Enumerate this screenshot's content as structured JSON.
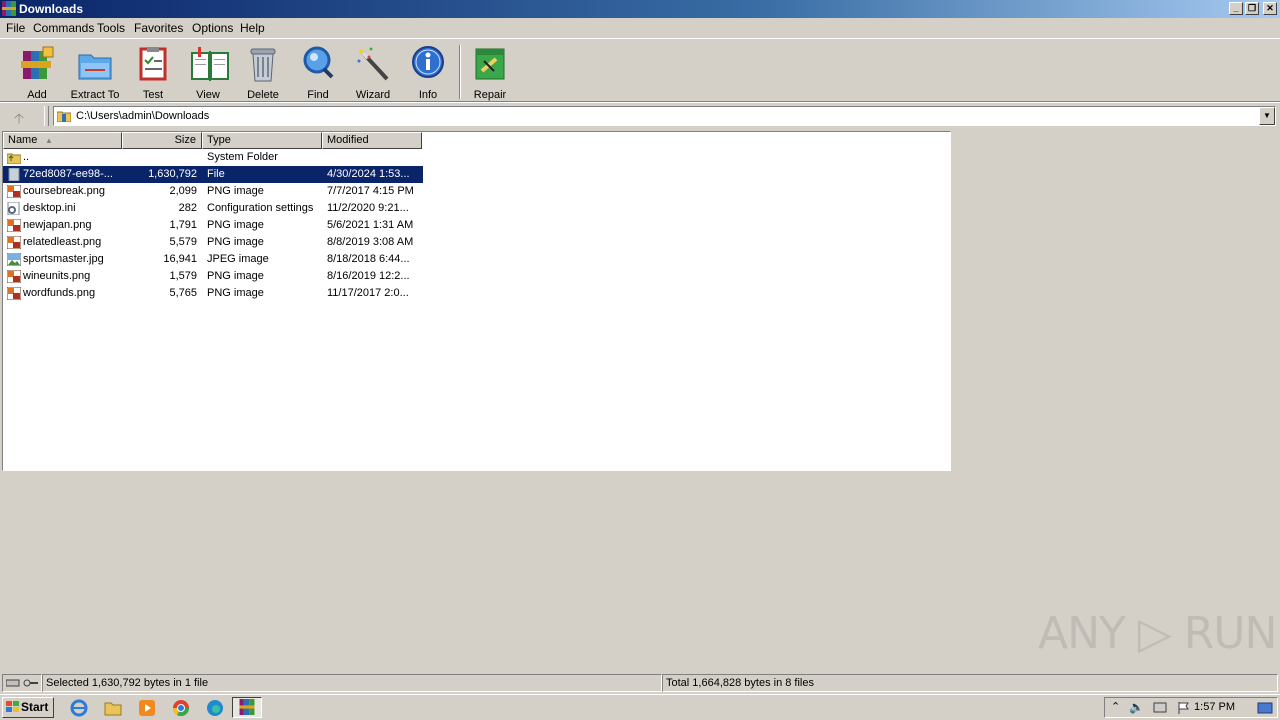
{
  "window": {
    "title": "Downloads",
    "min": "_",
    "restore": "❐",
    "close": "✕"
  },
  "menu": [
    "File",
    "Commands",
    "Tools",
    "Favorites",
    "Options",
    "Help"
  ],
  "toolbar": [
    "Add",
    "Extract To",
    "Test",
    "View",
    "Delete",
    "Find",
    "Wizard",
    "Info",
    "Repair"
  ],
  "address": {
    "path": "C:\\Users\\admin\\Downloads",
    "up": "🡡",
    "drop": "▼"
  },
  "columns": {
    "name": "Name",
    "size": "Size",
    "type": "Type",
    "modified": "Modified"
  },
  "files": [
    {
      "name": "..",
      "size": "",
      "type": "System Folder",
      "modified": "",
      "icon": "folder-up-icon"
    },
    {
      "name": "72ed8087-ee98-...",
      "size": "1,630,792",
      "type": "File",
      "modified": "4/30/2024 1:53...",
      "icon": "file-icon",
      "selected": true
    },
    {
      "name": "coursebreak.png",
      "size": "2,099",
      "type": "PNG image",
      "modified": "7/7/2017 4:15 PM",
      "icon": "png-icon"
    },
    {
      "name": "desktop.ini",
      "size": "282",
      "type": "Configuration settings",
      "modified": "11/2/2020 9:21...",
      "icon": "ini-icon"
    },
    {
      "name": "newjapan.png",
      "size": "1,791",
      "type": "PNG image",
      "modified": "5/6/2021 1:31 AM",
      "icon": "png-icon"
    },
    {
      "name": "relatedleast.png",
      "size": "5,579",
      "type": "PNG image",
      "modified": "8/8/2019 3:08 AM",
      "icon": "png-icon"
    },
    {
      "name": "sportsmaster.jpg",
      "size": "16,941",
      "type": "JPEG image",
      "modified": "8/18/2018 6:44...",
      "icon": "jpg-icon"
    },
    {
      "name": "wineunits.png",
      "size": "1,579",
      "type": "PNG image",
      "modified": "8/16/2019 12:2...",
      "icon": "png-icon"
    },
    {
      "name": "wordfunds.png",
      "size": "5,765",
      "type": "PNG image",
      "modified": "11/17/2017 2:0...",
      "icon": "png-icon"
    }
  ],
  "status": {
    "left": "Selected 1,630,792 bytes in 1 file",
    "right": "Total 1,664,828 bytes in 8 files"
  },
  "taskbar": {
    "start": "Start",
    "clock": "1:57 PM"
  },
  "watermark": "ANY ▷ RUN"
}
